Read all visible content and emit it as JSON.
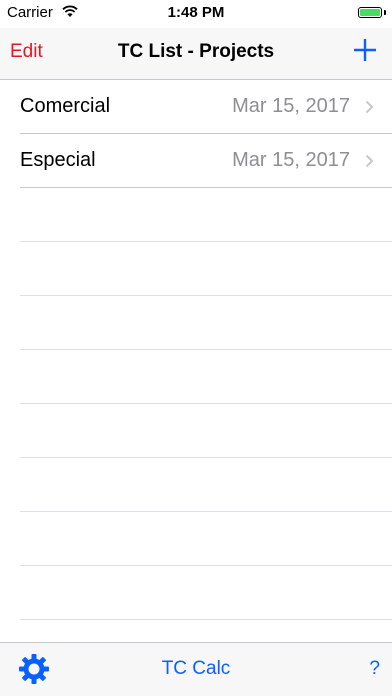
{
  "status": {
    "carrier": "Carrier",
    "time": "1:48 PM"
  },
  "nav": {
    "edit_label": "Edit",
    "title": "TC List - Projects",
    "add_icon": "plus-icon"
  },
  "projects": [
    {
      "name": "Comercial",
      "date": "Mar 15, 2017"
    },
    {
      "name": "Especial",
      "date": "Mar 15, 2017"
    }
  ],
  "toolbar": {
    "settings_icon": "gear-icon",
    "center_label": "TC Calc",
    "help_label": "?"
  },
  "colors": {
    "edit": "#e0191e",
    "accent": "#0a60fe",
    "detail": "#8e8e93"
  }
}
